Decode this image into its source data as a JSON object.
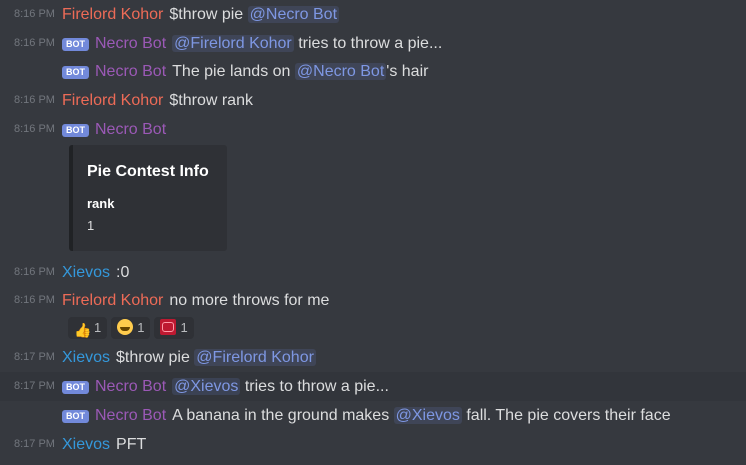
{
  "messages": [
    {
      "time": "8:16 PM",
      "author": "Firelord Kohor",
      "parts": [
        "$throw pie ",
        "@Necro Bot"
      ]
    },
    {
      "time": "8:16 PM",
      "bot": "BOT",
      "author": "Necro Bot",
      "parts": [
        "@Firelord Kohor",
        " tries to throw a pie..."
      ]
    },
    {
      "bot": "BOT",
      "author": "Necro Bot",
      "parts": [
        "The pie lands on ",
        "@Necro Bot",
        "'s hair"
      ]
    },
    {
      "time": "8:16 PM",
      "author": "Firelord Kohor",
      "parts": [
        "$throw rank"
      ]
    },
    {
      "time": "8:16 PM",
      "bot": "BOT",
      "author": "Necro Bot"
    },
    {
      "time": "8:16 PM",
      "author": "Xievos",
      "parts": [
        ":0"
      ]
    },
    {
      "time": "8:16 PM",
      "author": "Firelord Kohor",
      "parts": [
        "no more throws for me"
      ]
    },
    {
      "time": "8:17 PM",
      "author": "Xievos",
      "parts": [
        "$throw pie ",
        "@Firelord Kohor"
      ]
    },
    {
      "time": "8:17 PM",
      "bot": "BOT",
      "author": "Necro Bot",
      "parts": [
        "@Xievos",
        " tries to throw a pie..."
      ]
    },
    {
      "bot": "BOT",
      "author": "Necro Bot",
      "parts": [
        "A banana in the ground makes ",
        "@Xievos",
        " fall. The pie covers their face"
      ]
    },
    {
      "time": "8:17 PM",
      "author": "Xievos",
      "parts": [
        "PFT"
      ]
    }
  ],
  "embed": {
    "title": "Pie Contest Info",
    "field_name": "rank",
    "field_value": "1"
  },
  "reactions": [
    {
      "icon": "thumbs-up-icon",
      "count": "1"
    },
    {
      "icon": "grinning-squinting-face-icon",
      "count": "1"
    },
    {
      "icon": "hundred-points-icon",
      "count": "1"
    }
  ],
  "colors": {
    "background": "#36393f",
    "firelord_kohor": "#ed6b57",
    "necro_bot": "#9b59b6",
    "xievos": "#3498db",
    "mention": "#7e97e3",
    "bot_badge": "#7289da"
  }
}
